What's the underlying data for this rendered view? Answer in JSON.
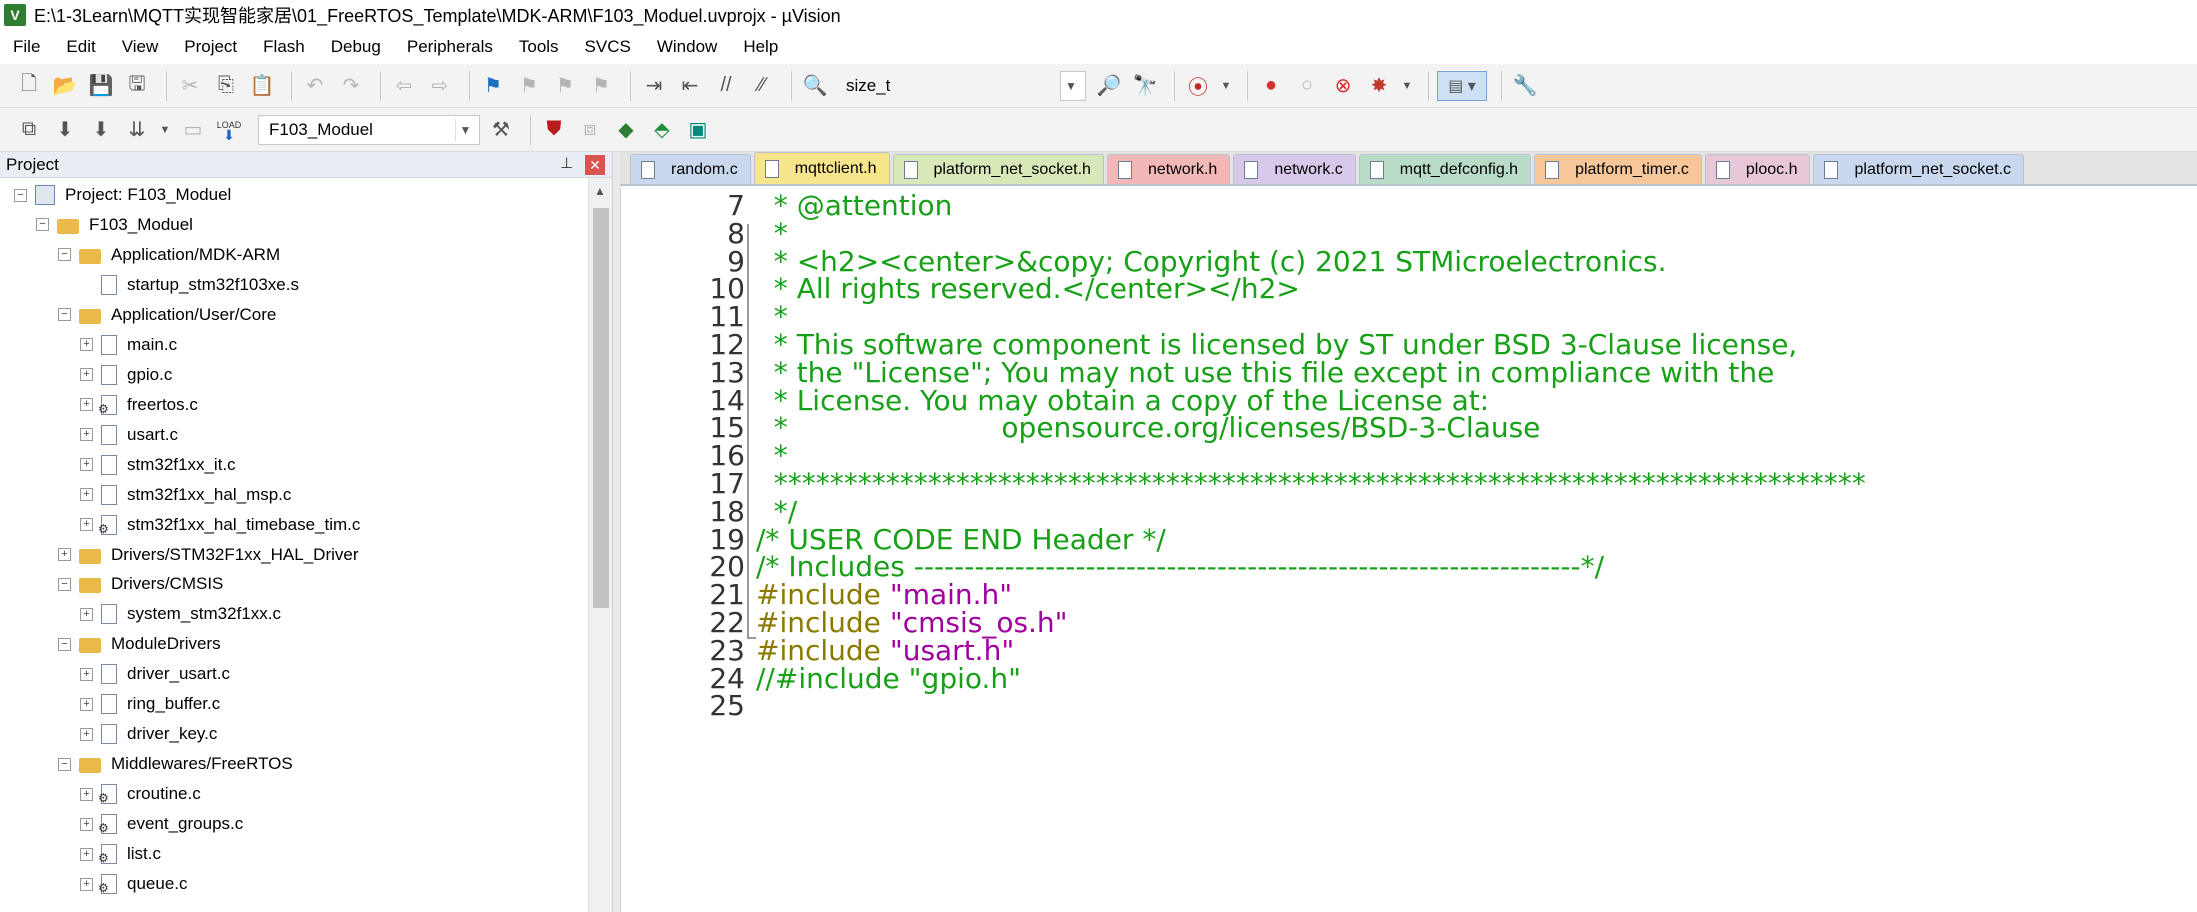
{
  "window": {
    "title": "E:\\1-3Learn\\MQTT实现智能家居\\01_FreeRTOS_Template\\MDK-ARM\\F103_Moduel.uvprojx - µVision",
    "app_icon": "V"
  },
  "menu": [
    "File",
    "Edit",
    "View",
    "Project",
    "Flash",
    "Debug",
    "Peripherals",
    "Tools",
    "SVCS",
    "Window",
    "Help"
  ],
  "toolbar1": {
    "find_combo_value": "size_t"
  },
  "toolbar2": {
    "target_combo_value": "F103_Moduel",
    "load_label": "LOAD"
  },
  "project_panel": {
    "title": "Project",
    "pin_glyph": "⊥",
    "close_glyph": "✕",
    "tree": [
      {
        "label": "Project: F103_Moduel",
        "level": 0,
        "icon": "project-icon",
        "expander": "−"
      },
      {
        "label": "F103_Moduel",
        "level": 1,
        "icon": "target-folder-icon",
        "expander": "−"
      },
      {
        "label": "Application/MDK-ARM",
        "level": 2,
        "icon": "folder-icon",
        "expander": "−"
      },
      {
        "label": "startup_stm32f103xe.s",
        "level": 3,
        "icon": "file-icon",
        "expander": ""
      },
      {
        "label": "Application/User/Core",
        "level": 2,
        "icon": "folder-icon",
        "expander": "−"
      },
      {
        "label": "main.c",
        "level": 3,
        "icon": "file-icon",
        "expander": "+"
      },
      {
        "label": "gpio.c",
        "level": 3,
        "icon": "file-icon",
        "expander": "+"
      },
      {
        "label": "freertos.c",
        "level": 3,
        "icon": "file-gear-icon",
        "expander": "+"
      },
      {
        "label": "usart.c",
        "level": 3,
        "icon": "file-icon",
        "expander": "+"
      },
      {
        "label": "stm32f1xx_it.c",
        "level": 3,
        "icon": "file-icon",
        "expander": "+"
      },
      {
        "label": "stm32f1xx_hal_msp.c",
        "level": 3,
        "icon": "file-icon",
        "expander": "+"
      },
      {
        "label": "stm32f1xx_hal_timebase_tim.c",
        "level": 3,
        "icon": "file-gear-icon",
        "expander": "+"
      },
      {
        "label": "Drivers/STM32F1xx_HAL_Driver",
        "level": 2,
        "icon": "folder-icon",
        "expander": "+"
      },
      {
        "label": "Drivers/CMSIS",
        "level": 2,
        "icon": "folder-icon",
        "expander": "−"
      },
      {
        "label": "system_stm32f1xx.c",
        "level": 3,
        "icon": "file-icon",
        "expander": "+"
      },
      {
        "label": "ModuleDrivers",
        "level": 2,
        "icon": "folder-icon",
        "expander": "−"
      },
      {
        "label": "driver_usart.c",
        "level": 3,
        "icon": "file-icon",
        "expander": "+"
      },
      {
        "label": "ring_buffer.c",
        "level": 3,
        "icon": "file-icon",
        "expander": "+"
      },
      {
        "label": "driver_key.c",
        "level": 3,
        "icon": "file-icon",
        "expander": "+"
      },
      {
        "label": "Middlewares/FreeRTOS",
        "level": 2,
        "icon": "folder-gear-icon",
        "expander": "−"
      },
      {
        "label": "croutine.c",
        "level": 3,
        "icon": "file-gear-icon",
        "expander": "+"
      },
      {
        "label": "event_groups.c",
        "level": 3,
        "icon": "file-gear-icon",
        "expander": "+"
      },
      {
        "label": "list.c",
        "level": 3,
        "icon": "file-gear-icon",
        "expander": "+"
      },
      {
        "label": "queue.c",
        "level": 3,
        "icon": "file-gear-icon",
        "expander": "+"
      }
    ]
  },
  "tabs": [
    {
      "label": "random.c",
      "color": "#c9d8ef",
      "active": false
    },
    {
      "label": "mqttclient.h",
      "color": "#f7e58c",
      "active": true
    },
    {
      "label": "platform_net_socket.h",
      "color": "#d8e8b8",
      "active": false
    },
    {
      "label": "network.h",
      "color": "#f2b7b7",
      "active": false
    },
    {
      "label": "network.c",
      "color": "#d8c8ea",
      "active": false
    },
    {
      "label": "mqtt_defconfig.h",
      "color": "#b8dcc8",
      "active": false
    },
    {
      "label": "platform_timer.c",
      "color": "#f7c79a",
      "active": false
    },
    {
      "label": "plooc.h",
      "color": "#e8c8d8",
      "active": false
    },
    {
      "label": "platform_net_socket.c",
      "color": "#c9d8ef",
      "active": false
    }
  ],
  "editor": {
    "lines": [
      {
        "num": "7",
        "segments": [
          {
            "text": "  * @attention",
            "color": "green"
          }
        ]
      },
      {
        "num": "8",
        "segments": [
          {
            "text": "  *",
            "color": "green"
          }
        ]
      },
      {
        "num": "9",
        "segments": [
          {
            "text": "  * <h2><center>&copy; Copyright (c) 2021 STMicroelectronics.",
            "color": "green"
          }
        ]
      },
      {
        "num": "10",
        "segments": [
          {
            "text": "  * All rights reserved.</center></h2>",
            "color": "green"
          }
        ]
      },
      {
        "num": "11",
        "segments": [
          {
            "text": "  *",
            "color": "green"
          }
        ]
      },
      {
        "num": "12",
        "segments": [
          {
            "text": "  * This software component is licensed by ST under BSD 3-Clause license,",
            "color": "green"
          }
        ]
      },
      {
        "num": "13",
        "segments": [
          {
            "text": "  * the \"License\"; You may not use this file except in compliance with the",
            "color": "green"
          }
        ]
      },
      {
        "num": "14",
        "segments": [
          {
            "text": "  * License. You may obtain a copy of the License at:",
            "color": "green"
          }
        ]
      },
      {
        "num": "15",
        "segments": [
          {
            "text": "  *                        opensource.org/licenses/BSD-3-Clause",
            "color": "green"
          }
        ]
      },
      {
        "num": "16",
        "segments": [
          {
            "text": "  *",
            "color": "green"
          }
        ]
      },
      {
        "num": "17",
        "segments": [
          {
            "text": "  ******************************************************************************",
            "color": "green"
          }
        ]
      },
      {
        "num": "18",
        "segments": [
          {
            "text": "  */",
            "color": "green"
          }
        ]
      },
      {
        "num": "19",
        "segments": [
          {
            "text": "/* USER CODE END Header */",
            "color": "green"
          }
        ]
      },
      {
        "num": "20",
        "segments": [
          {
            "text": "/* Includes ------------------------------------------------------------------*/",
            "color": "green"
          }
        ]
      },
      {
        "num": "21",
        "segments": [
          {
            "text": "#include ",
            "color": "olive"
          },
          {
            "text": "\"main.h\"",
            "color": "purple"
          }
        ]
      },
      {
        "num": "22",
        "segments": [
          {
            "text": "#include ",
            "color": "olive"
          },
          {
            "text": "\"cmsis_os.h\"",
            "color": "purple"
          }
        ]
      },
      {
        "num": "23",
        "segments": [
          {
            "text": "#include ",
            "color": "olive"
          },
          {
            "text": "\"usart.h\"",
            "color": "purple"
          }
        ]
      },
      {
        "num": "24",
        "segments": [
          {
            "text": "//#include \"gpio.h\"",
            "color": "green"
          }
        ]
      },
      {
        "num": "25",
        "segments": []
      }
    ]
  }
}
